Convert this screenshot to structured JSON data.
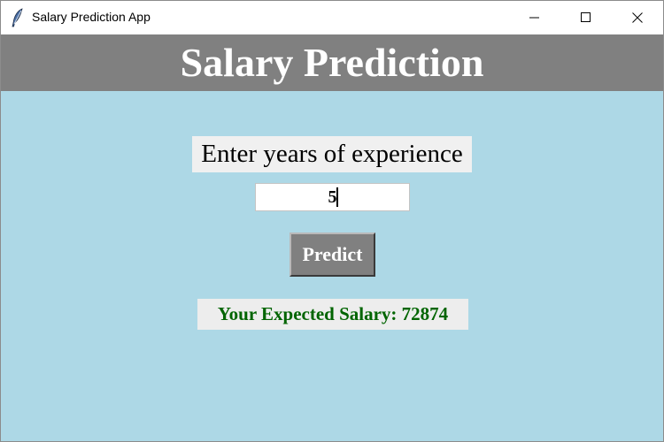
{
  "window": {
    "title": "Salary Prediction App",
    "controls": {
      "minimize_icon": "minimize-icon",
      "maximize_icon": "maximize-icon",
      "close_icon": "close-icon"
    },
    "app_icon": "feather-icon"
  },
  "header": {
    "title": "Salary Prediction",
    "background": "#808080"
  },
  "form": {
    "prompt": "Enter years of experience",
    "experience_value": "5",
    "predict_label": "Predict"
  },
  "result": {
    "text": "Your Expected Salary: 72874",
    "color": "#006400"
  },
  "colors": {
    "page_background": "#add8e6",
    "label_background": "#f0f0f0",
    "button_background": "#808080"
  }
}
